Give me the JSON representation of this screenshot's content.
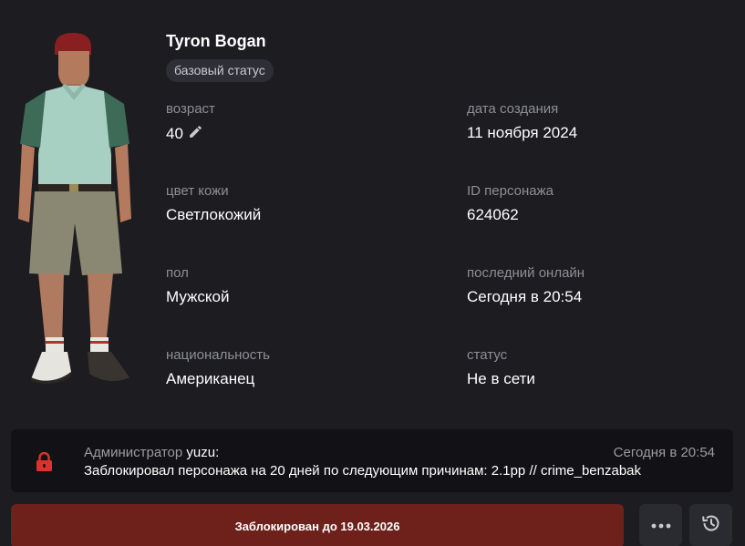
{
  "character": {
    "name": "Tyron Bogan",
    "status_badge": "базовый статус"
  },
  "fields": {
    "age": {
      "label": "возраст",
      "value": "40"
    },
    "created": {
      "label": "дата создания",
      "value": "11 ноября 2024"
    },
    "skin": {
      "label": "цвет кожи",
      "value": "Светлокожий"
    },
    "char_id": {
      "label": "ID персонажа",
      "value": "624062"
    },
    "gender": {
      "label": "пол",
      "value": "Мужской"
    },
    "last_online": {
      "label": "последний онлайн",
      "value": "Сегодня в 20:54"
    },
    "nationality": {
      "label": "национальность",
      "value": "Американец"
    },
    "status": {
      "label": "статус",
      "value": "Не в сети"
    }
  },
  "notice": {
    "prefix": "Администратор",
    "admin": "yuzu:",
    "time": "Сегодня в 20:54",
    "message": "Заблокировал персонажа на 20 дней по следующим причинам: 2.1pp // crime_benzabak"
  },
  "actions": {
    "blocked_label": "Заблокирован до 19.03.2026",
    "more_icon": "more-dots-icon",
    "history_icon": "history-clock-icon"
  },
  "colors": {
    "background": "#1c1c21",
    "notice_bg": "#121216",
    "blocked_btn": "#6e201b",
    "lock": "#d9342b"
  }
}
